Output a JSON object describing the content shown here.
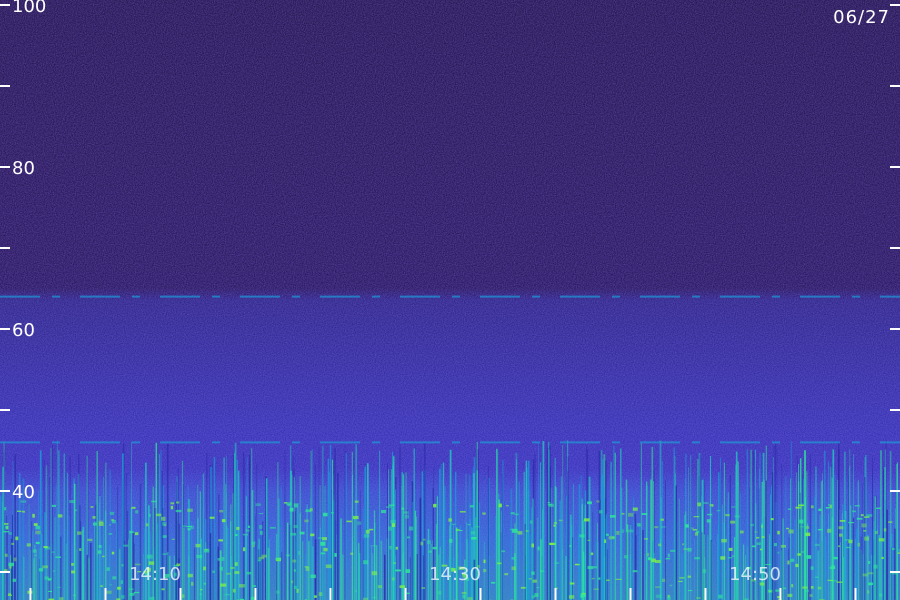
{
  "chart_data": {
    "type": "heatmap",
    "date": "06/27",
    "y_axis": {
      "range": [
        30,
        100
      ],
      "labeled_ticks": [
        "40",
        "60",
        "80",
        "100"
      ],
      "tick_values": [
        30,
        40,
        50,
        60,
        70,
        80,
        90,
        100
      ]
    },
    "x_axis": {
      "labeled_ticks": [
        {
          "label": "14:10",
          "minute": 10
        },
        {
          "label": "14:30",
          "minute": 30
        },
        {
          "label": "14:50",
          "minute": 50
        }
      ],
      "tick_minutes": [
        2,
        7,
        12,
        17,
        22,
        27,
        32,
        37,
        42,
        47,
        52,
        57
      ],
      "range_minutes": [
        0,
        60
      ]
    },
    "bands": [
      {
        "y": 64,
        "description": "thin horizontal emission line"
      },
      {
        "y": 46,
        "description": "thin horizontal emission line"
      }
    ],
    "colors": {
      "background": "#1a0a48",
      "mid": "#2a2aa8",
      "high": "#1e9ad8",
      "peak": "#2ee89a",
      "axis": "#ffffff"
    }
  }
}
